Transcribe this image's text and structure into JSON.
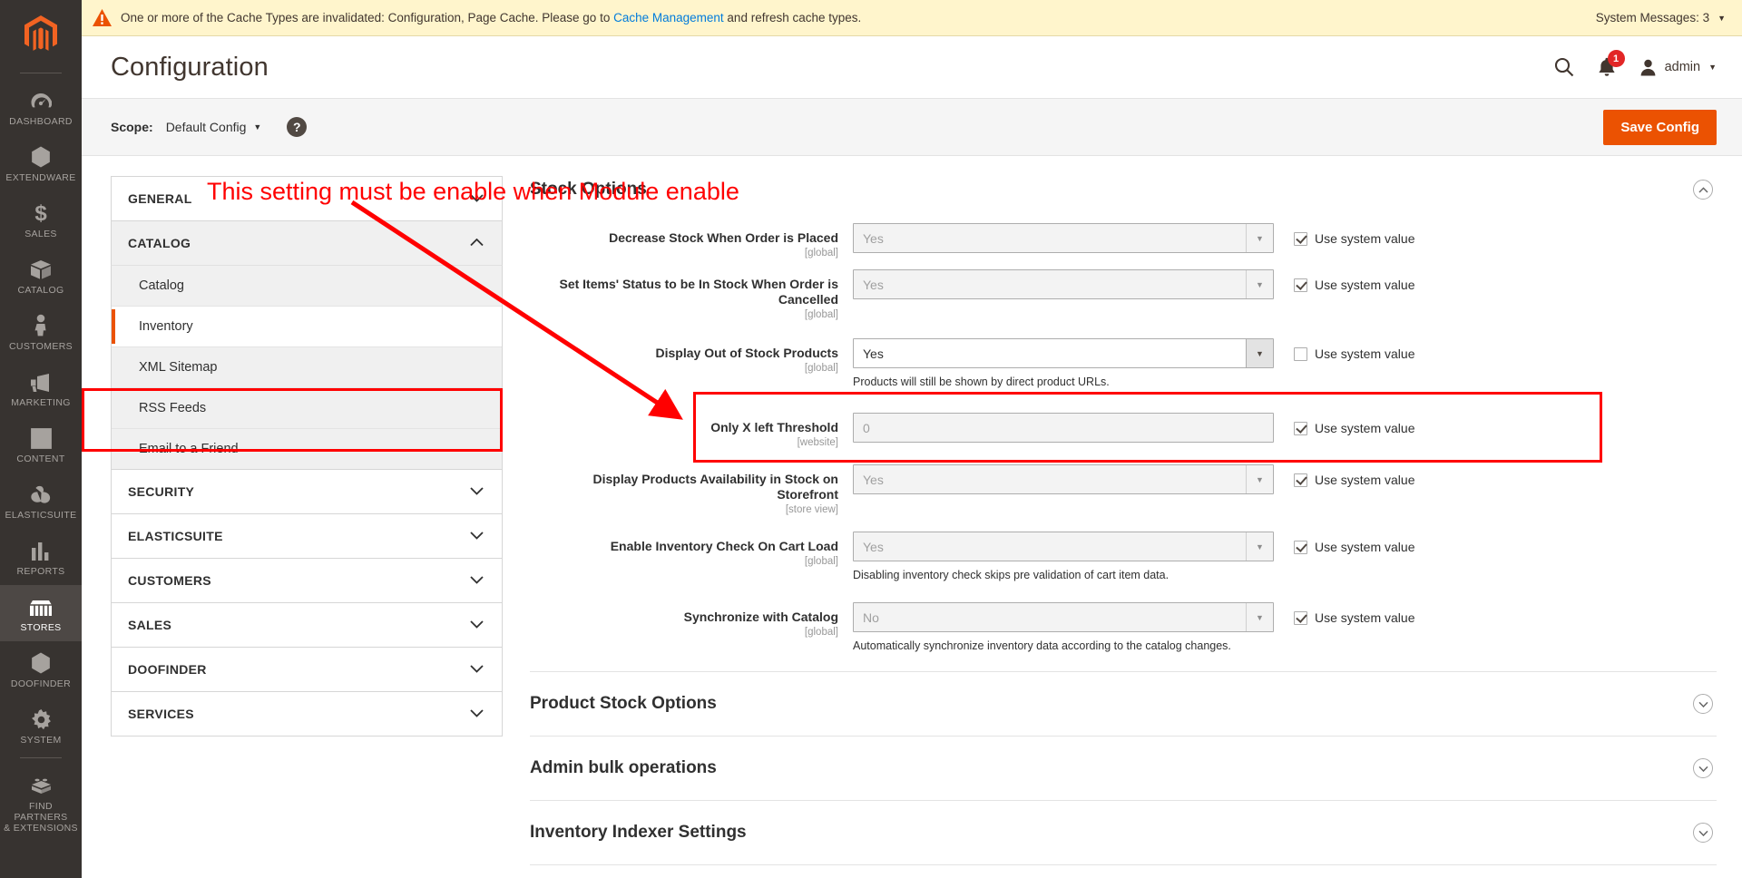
{
  "messages_bar": {
    "warning_icon": "warning-triangle-icon",
    "text_before_link": "One or more of the Cache Types are invalidated: Configuration, Page Cache. Please go to ",
    "link_label": "Cache Management",
    "text_after_link": " and refresh cache types.",
    "system_messages_label": "System Messages: 3",
    "caret": "▼"
  },
  "header": {
    "title": "Configuration",
    "search_icon": "search-icon",
    "notifications_icon": "bell-icon",
    "notifications_count": "1",
    "user_icon": "user-avatar-icon",
    "user_name": "admin",
    "user_caret": "▼"
  },
  "scope_bar": {
    "label": "Scope:",
    "value": "Default Config",
    "caret": "▼",
    "help_icon": "question-mark-icon",
    "help_glyph": "?",
    "save_button": "Save Config"
  },
  "admin_sidebar": {
    "logo": "magento-logo-icon",
    "items": [
      {
        "label": "Dashboard",
        "icon": "dashboard-gauge-icon",
        "active": false
      },
      {
        "label": "Extendware",
        "icon": "hexagon-icon",
        "active": false
      },
      {
        "label": "Sales",
        "icon": "dollar-sign-icon",
        "active": false
      },
      {
        "label": "Catalog",
        "icon": "box-icon",
        "active": false
      },
      {
        "label": "Customers",
        "icon": "person-icon",
        "active": false
      },
      {
        "label": "Marketing",
        "icon": "megaphone-icon",
        "active": false
      },
      {
        "label": "Content",
        "icon": "layout-panel-icon",
        "active": false
      },
      {
        "label": "Elasticsuite",
        "icon": "rabbit-icon",
        "active": false
      },
      {
        "label": "Reports",
        "icon": "bar-chart-icon",
        "active": false
      },
      {
        "label": "Stores",
        "icon": "storefront-icon",
        "active": true
      },
      {
        "label": "Doofinder",
        "icon": "hexagon-icon",
        "active": false
      },
      {
        "label": "System",
        "icon": "gear-icon",
        "active": false
      },
      {
        "label": "Find Partners\n& Extensions",
        "icon": "lego-brick-icon",
        "active": false
      }
    ]
  },
  "config_nav": {
    "sections": [
      {
        "label": "General",
        "open": false,
        "chevron": "down",
        "children": []
      },
      {
        "label": "Catalog",
        "open": true,
        "chevron": "up",
        "children": [
          {
            "label": "Catalog",
            "current": false
          },
          {
            "label": "Inventory",
            "current": true
          },
          {
            "label": "XML Sitemap",
            "current": false
          },
          {
            "label": "RSS Feeds",
            "current": false
          },
          {
            "label": "Email to a Friend",
            "current": false
          }
        ]
      },
      {
        "label": "Security",
        "open": false,
        "chevron": "down",
        "children": []
      },
      {
        "label": "Elasticsuite",
        "open": false,
        "chevron": "down",
        "children": []
      },
      {
        "label": "Customers",
        "open": false,
        "chevron": "down",
        "children": []
      },
      {
        "label": "Sales",
        "open": false,
        "chevron": "down",
        "children": []
      },
      {
        "label": "Doofinder",
        "open": false,
        "chevron": "down",
        "children": []
      },
      {
        "label": "Services",
        "open": false,
        "chevron": "down",
        "children": []
      }
    ]
  },
  "main": {
    "section_title": "Stock Options",
    "collapse_icon": "chevron-up-circle-icon",
    "fields": [
      {
        "label": "Decrease Stock When Order is Placed",
        "scope": "[global]",
        "control": "select",
        "value": "Yes",
        "disabled": true,
        "note": "",
        "use_system_value": {
          "label": "Use system value",
          "checked": true
        }
      },
      {
        "label": "Set Items' Status to be In Stock When Order is Cancelled",
        "scope": "[global]",
        "control": "select",
        "value": "Yes",
        "disabled": true,
        "note": "",
        "use_system_value": {
          "label": "Use system value",
          "checked": true
        }
      },
      {
        "label": "Display Out of Stock Products",
        "scope": "[global]",
        "control": "select",
        "value": "Yes",
        "disabled": false,
        "note": "Products will still be shown by direct product URLs.",
        "use_system_value": {
          "label": "Use system value",
          "checked": false
        }
      },
      {
        "label": "Only X left Threshold",
        "scope": "[website]",
        "control": "text",
        "value": "0",
        "disabled": true,
        "note": "",
        "use_system_value": {
          "label": "Use system value",
          "checked": true
        }
      },
      {
        "label": "Display Products Availability in Stock on Storefront",
        "scope": "[store view]",
        "control": "select",
        "value": "Yes",
        "disabled": true,
        "note": "",
        "use_system_value": {
          "label": "Use system value",
          "checked": true
        }
      },
      {
        "label": "Enable Inventory Check On Cart Load",
        "scope": "[global]",
        "control": "select",
        "value": "Yes",
        "disabled": true,
        "note": "Disabling inventory check skips pre validation of cart item data.",
        "use_system_value": {
          "label": "Use system value",
          "checked": true
        }
      },
      {
        "label": "Synchronize with Catalog",
        "scope": "[global]",
        "control": "select",
        "value": "No",
        "disabled": true,
        "note": "Automatically synchronize inventory data according to the catalog changes.",
        "use_system_value": {
          "label": "Use system value",
          "checked": true
        }
      }
    ],
    "collapsed_sections": [
      {
        "label": "Product Stock Options",
        "icon": "chevron-down-circle-icon"
      },
      {
        "label": "Admin bulk operations",
        "icon": "chevron-down-circle-icon"
      },
      {
        "label": "Inventory Indexer Settings",
        "icon": "chevron-down-circle-icon"
      }
    ]
  },
  "annotations": {
    "note_text": "This setting must be enable when Module enable",
    "note_color": "#ff0000",
    "highlight_color": "#ff0000",
    "arrow_icon": "red-arrow-icon"
  }
}
